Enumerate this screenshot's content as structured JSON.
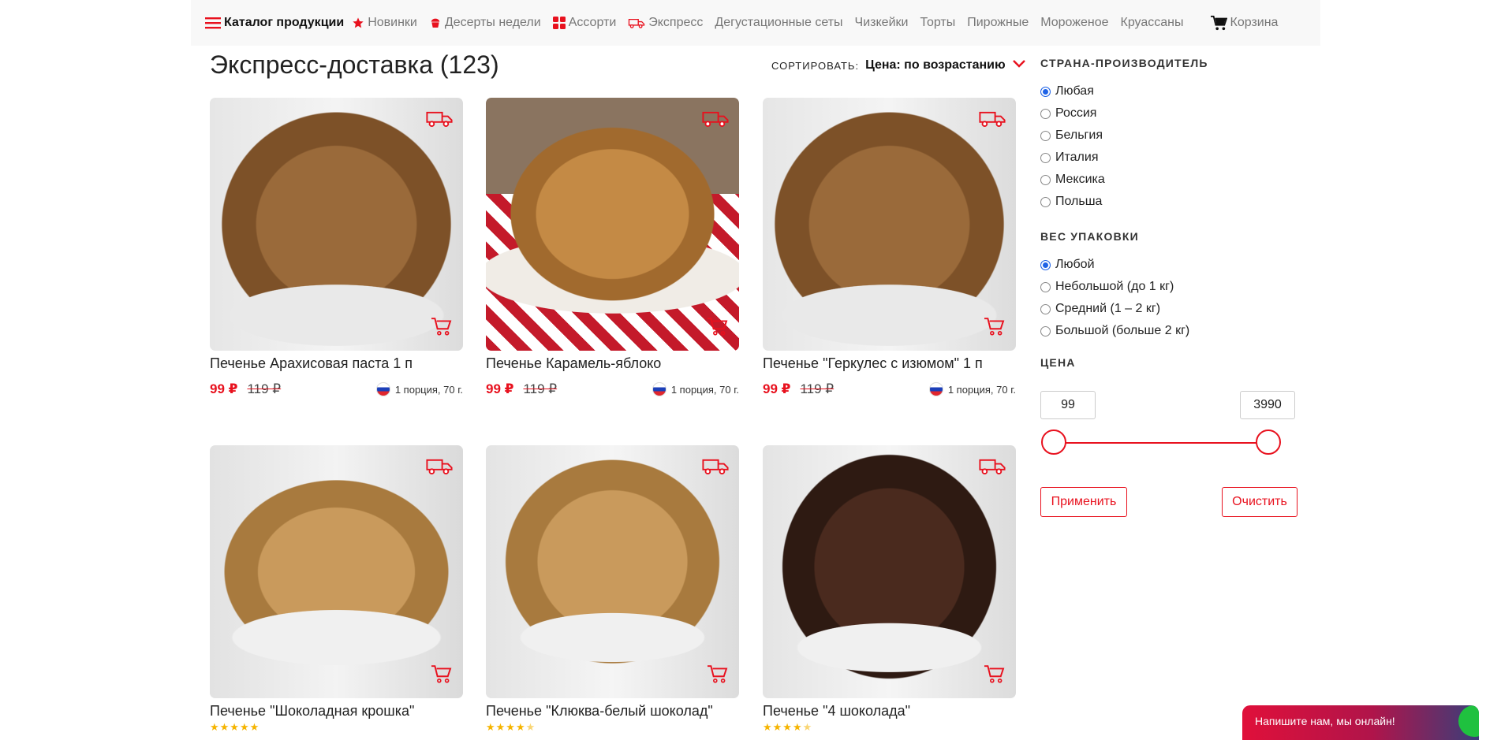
{
  "nav": {
    "catalog": "Каталог продукции",
    "items": [
      {
        "label": "Новинки",
        "icon": "star-icon"
      },
      {
        "label": "Десерты недели",
        "icon": "cupcake-icon"
      },
      {
        "label": "Ассорти",
        "icon": "grid-icon"
      },
      {
        "label": "Экспресс",
        "icon": "delivery-icon"
      },
      {
        "label": "Дегустационные сеты"
      },
      {
        "label": "Чизкейки"
      },
      {
        "label": "Торты"
      },
      {
        "label": "Пирожные"
      },
      {
        "label": "Мороженое"
      },
      {
        "label": "Круассаны"
      }
    ],
    "cart": "Корзина"
  },
  "page": {
    "title": "Экспресс-доставка (123)"
  },
  "sort": {
    "label": "СОРТИРОВАТЬ:",
    "value": "Цена: по возрастанию"
  },
  "products": [
    {
      "name": "Печенье Арахисовая паста 1 п",
      "price": "99 ₽",
      "old_price": "119 ₽",
      "portion": "1 порция, 70 г."
    },
    {
      "name": "Печенье Карамель-яблоко",
      "price": "99 ₽",
      "old_price": "119 ₽",
      "portion": "1 порция, 70 г."
    },
    {
      "name": "Печенье \"Геркулес с изюмом\" 1 п",
      "price": "99 ₽",
      "old_price": "119 ₽",
      "portion": "1 порция, 70 г."
    },
    {
      "name": "Печенье \"Шоколадная крошка\"",
      "rating": 5
    },
    {
      "name": "Печенье \"Клюква-белый шоколад\"",
      "rating": 4.5
    },
    {
      "name": "Печенье \"4 шоколада\"",
      "rating": 4.5
    }
  ],
  "filters": {
    "country": {
      "title": "СТРАНА-ПРОИЗВОДИТЕЛЬ",
      "options": [
        "Любая",
        "Россия",
        "Бельгия",
        "Италия",
        "Мексика",
        "Польша"
      ],
      "selected": 0
    },
    "weight": {
      "title": "ВЕС УПАКОВКИ",
      "options": [
        "Любой",
        "Небольшой (до 1 кг)",
        "Средний (1 – 2 кг)",
        "Большой (больше 2 кг)"
      ],
      "selected": 0
    },
    "price": {
      "title": "ЦЕНА",
      "min": "99",
      "max": "3990"
    },
    "apply": "Применить",
    "clear": "Очистить"
  },
  "chat": {
    "label": "Напишите нам, мы онлайн!"
  },
  "colors": {
    "accent": "#e8111e",
    "star": "#f5b400"
  }
}
